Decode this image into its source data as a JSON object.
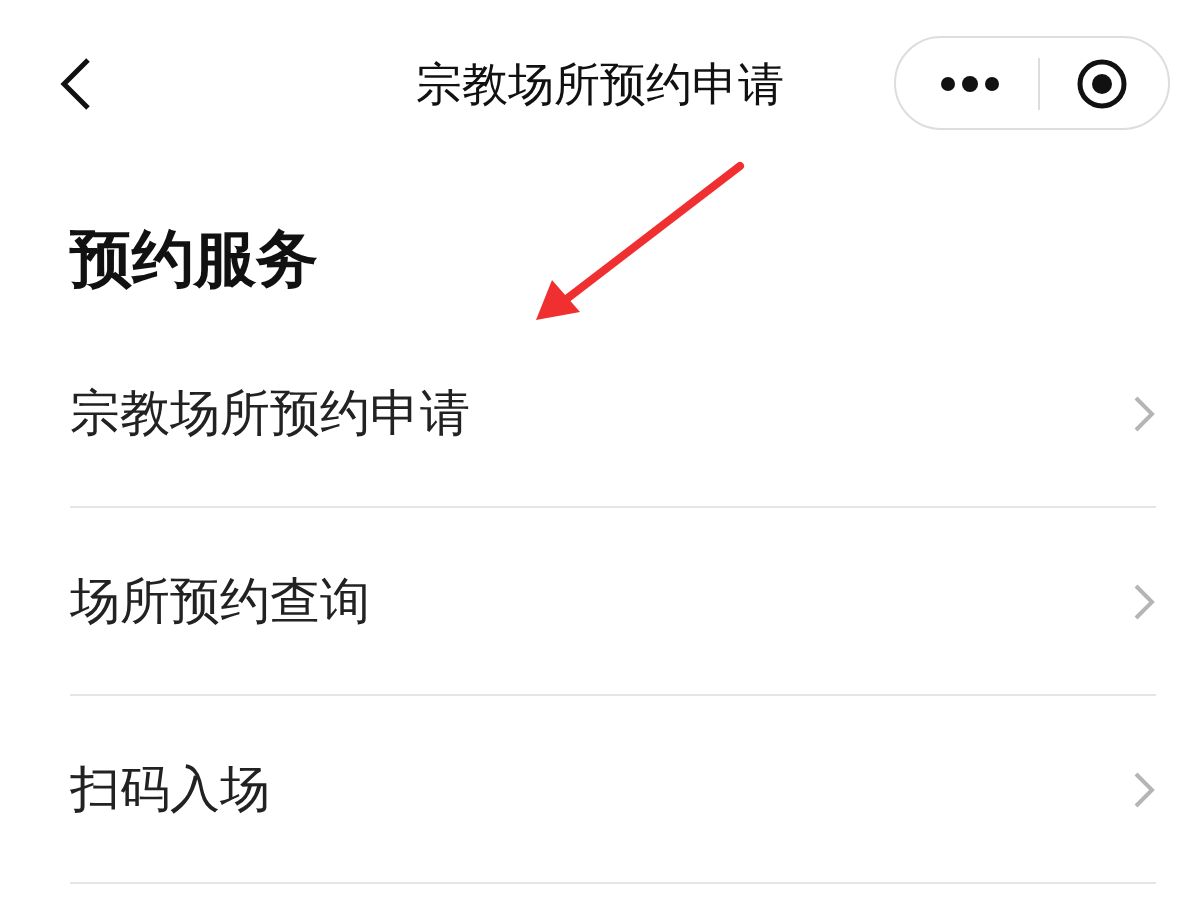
{
  "nav_bar": {
    "title": "宗教场所预约申请"
  },
  "section": {
    "title": "预约服务",
    "items": [
      {
        "label": "宗教场所预约申请",
        "highlighted": true
      },
      {
        "label": "场所预约查询",
        "highlighted": false
      },
      {
        "label": "扫码入场",
        "highlighted": false
      }
    ]
  }
}
